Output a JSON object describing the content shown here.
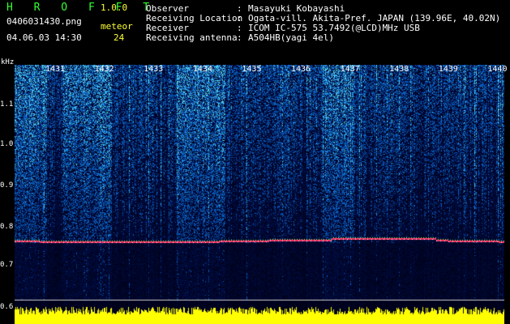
{
  "header": {
    "logo": "H R O F F T",
    "version": "1.0.0",
    "filename": "0406031430.png",
    "datetime": "04.06.03 14:30",
    "meteor_label": "meteor",
    "meteor_count": "24"
  },
  "info": [
    {
      "label": "Observer",
      "value": "Masayuki Kobayashi"
    },
    {
      "label": "Receiving Location",
      "value": "Ogata-vill. Akita-Pref. JAPAN (139.96E, 40.02N)"
    },
    {
      "label": "Receiver",
      "value": "ICOM IC-575 53.7492(@LCD)MHz USB"
    },
    {
      "label": "Receiving antenna",
      "value": "A504HB(yagi 4el)"
    }
  ],
  "colon": ":",
  "axis": {
    "y_unit": "kHz",
    "y_ticks": [
      "1.1",
      "1.0",
      "0.9",
      "0.8",
      "0.7",
      "0.6"
    ],
    "x_ticks": [
      "1431",
      "1432",
      "1433",
      "1434",
      "1435",
      "1436",
      "1437",
      "1438",
      "1439",
      "1440"
    ]
  },
  "colors": {
    "background": "#000000",
    "logo": "#33ff33",
    "accent": "#ffff33",
    "signal_trace": "#ff3366",
    "spectrum_low": "#001050",
    "spectrum_high": "#40c0ff",
    "baseline_bars": "#ffff00"
  }
}
